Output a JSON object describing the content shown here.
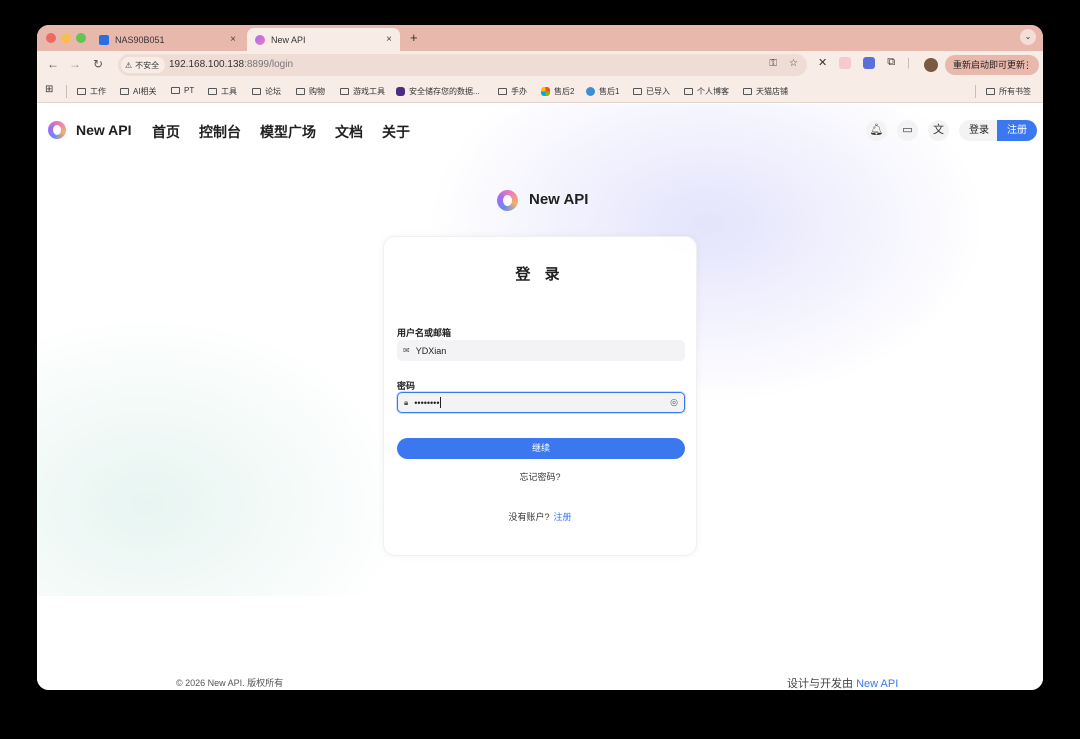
{
  "tabs": [
    {
      "title": "NAS90B051",
      "close": "×"
    },
    {
      "title": "New API",
      "close": "×"
    }
  ],
  "new_tab": "+",
  "tab_menu": "⌄",
  "toolbar": {
    "insecure": "不安全",
    "url_host": "192.168.100.138",
    "url_rest": ":8899/login",
    "update_label": "重新启动即可更新",
    "update_menu": "⋮"
  },
  "bookmarks": {
    "items": [
      "工作",
      "AI相关",
      "PT",
      "工具",
      "论坛",
      "购物",
      "游戏工具",
      "安全储存您的数据...",
      "手办",
      "售后2",
      "售后1",
      "已导入",
      "个人博客",
      "天猫店铺"
    ],
    "all_bookmarks": "所有书签"
  },
  "header": {
    "brand": "New API",
    "nav": [
      "首页",
      "控制台",
      "模型广场",
      "文档",
      "关于"
    ],
    "login": "登录",
    "register": "注册"
  },
  "center_brand": "New API",
  "login_card": {
    "title": "登 录",
    "username_label": "用户名或邮箱",
    "username_value": "YDXian",
    "password_label": "密码",
    "password_value": "••••••••",
    "submit": "继续",
    "forgot": "忘记密码?",
    "no_account": "没有账户?",
    "register_link": "注册"
  },
  "footer": {
    "copyright": "© 2026 New API. 版权所有",
    "credit_prefix": "设计与开发由",
    "credit_link": "New API"
  }
}
